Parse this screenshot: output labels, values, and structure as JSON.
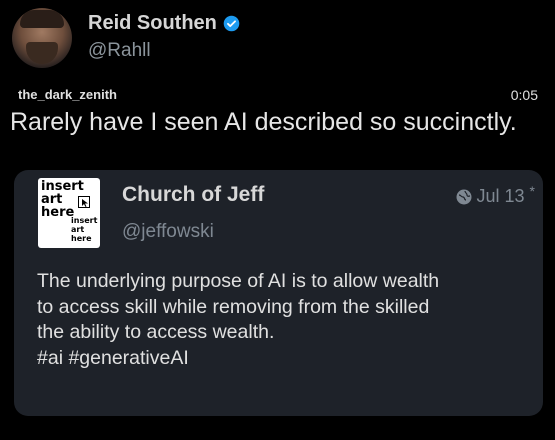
{
  "post": {
    "author_name": "Reid Southen",
    "author_handle": "@Rahll",
    "video_label": "the_dark_zenith",
    "video_time": "0:05",
    "caption": "Rarely have I seen AI described so succinctly."
  },
  "quoted": {
    "logo_text": "insert art here",
    "logo_small_text": "insert art here",
    "name": "Church of Jeff",
    "handle": "@jeffowski",
    "date": "Jul 13",
    "date_marker": "*",
    "body_lines": [
      "The underlying purpose of AI is to allow wealth",
      "to access skill while removing from the skilled",
      "the ability to access wealth.",
      "#ai #generativeAI"
    ]
  },
  "colors": {
    "background": "#000000",
    "card_background": "#1e2229",
    "verified_badge": "#1d9bf0",
    "muted_text": "#7f8892"
  },
  "icons": [
    "verified-badge-icon",
    "globe-icon",
    "cursor-icon"
  ]
}
